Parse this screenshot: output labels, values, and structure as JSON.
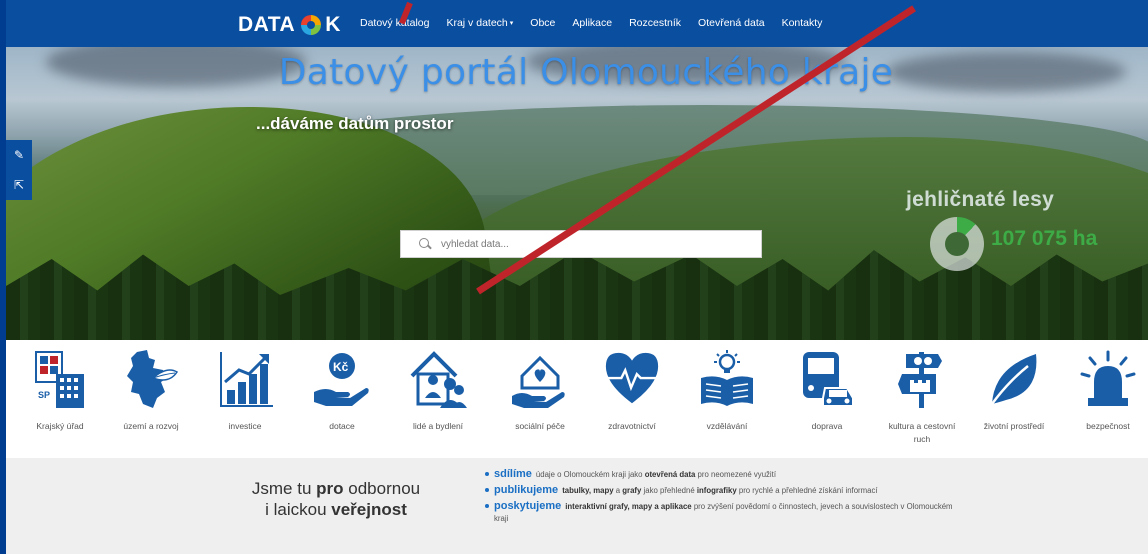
{
  "nav": {
    "logo_left": "DATA",
    "logo_right": "K",
    "items": [
      {
        "label": "Datový katalog"
      },
      {
        "label": "Kraj v datech",
        "has_dropdown": true
      },
      {
        "label": "Obce"
      },
      {
        "label": "Aplikace"
      },
      {
        "label": "Rozcestník"
      },
      {
        "label": "Otevřená data"
      },
      {
        "label": "Kontakty"
      }
    ]
  },
  "hero": {
    "title": "Datový portál Olomouckého kraje",
    "subtitle": "...dáváme datům prostor",
    "search_placeholder": "vyhledat data...",
    "stat_label": "jehličnaté lesy",
    "stat_value": "107 075 ha",
    "stat_share": 0.12
  },
  "side_tools": [
    {
      "icon": "pencil-icon"
    },
    {
      "icon": "share-icon"
    }
  ],
  "categories": [
    {
      "label": "Krajský úřad",
      "icon": "regional-office-icon"
    },
    {
      "label": "území a rozvoj",
      "icon": "region-map-icon"
    },
    {
      "label": "investice",
      "icon": "growth-chart-icon"
    },
    {
      "label": "dotace",
      "icon": "subsidy-hand-icon"
    },
    {
      "label": "lidé a bydlení",
      "icon": "people-house-icon"
    },
    {
      "label": "sociální péče",
      "icon": "care-house-icon"
    },
    {
      "label": "zdravotnictví",
      "icon": "heartbeat-icon"
    },
    {
      "label": "vzdělávání",
      "icon": "education-icon"
    },
    {
      "label": "doprava",
      "icon": "transport-icon"
    },
    {
      "label": "kultura a cestovní ruch",
      "icon": "culture-sign-icon"
    },
    {
      "label": "životní prostředí",
      "icon": "leaf-icon"
    },
    {
      "label": "bezpečnost",
      "icon": "alarm-light-icon"
    }
  ],
  "tagline": {
    "part1": "Jsme tu ",
    "part2": "pro",
    "part3": " odbornou",
    "part4": "i laickou ",
    "part5": "veřejnost"
  },
  "points": [
    {
      "verb": "sdílíme",
      "t1": "údaje o Olomouckém kraji jako ",
      "b1": "otevřená data",
      "t2": " pro neomezené využití",
      "b2": "",
      "t3": "",
      "b3": "",
      "t4": ""
    },
    {
      "verb": "publikujeme",
      "t1": "",
      "b1": "tabulky, mapy",
      "t2": " a ",
      "b2": "grafy",
      "t3": " jako přehledné ",
      "b3": "infografiky",
      "t4": " pro rychlé a přehledné získání informací"
    },
    {
      "verb": "poskytujeme",
      "t1": "",
      "b1": "interaktivní grafy, mapy a aplikace",
      "t2": " pro zvýšení povědomí o činnostech, jevech a souvislostech v Olomouckém kraji",
      "b2": "",
      "t3": "",
      "b3": "",
      "t4": ""
    }
  ],
  "colors": {
    "nav": "#0a4ea0",
    "accent_blue": "#1a6fc4",
    "stat_green": "#3db44a",
    "arrow_red": "#c0242b"
  }
}
